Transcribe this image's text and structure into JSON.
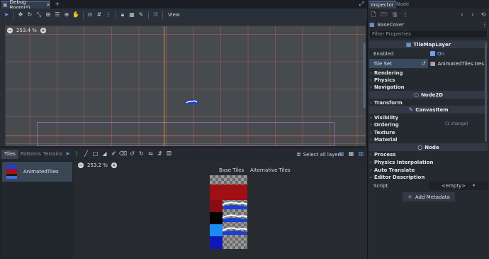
{
  "editor": {
    "scene_tab": "Debug Room(*)",
    "viewport_zoom": "253.4 %",
    "view_menu": "View"
  },
  "bottom_panel": {
    "tabs": [
      "Tiles",
      "Patterns",
      "Terrains"
    ],
    "select_all_layers": "Select all layers",
    "tileset_source": "AnimatedTiles",
    "atlas_zoom": "253.2 %",
    "base_tiles_label": "Base Tiles",
    "alternative_tiles_label": "Alternative Tiles"
  },
  "inspector": {
    "tabs": [
      "Inspector",
      "Node"
    ],
    "selected_node": "BaseCover",
    "filter_placeholder": "Filter Properties",
    "class_tilemaplayer": "TileMapLayer",
    "enabled_label": "Enabled",
    "enabled_value": "On",
    "tile_set_label": "Tile Set",
    "tile_set_value": "AnimatedTiles.tres",
    "tilemap_props": [
      "Rendering",
      "Physics",
      "Navigation"
    ],
    "class_node2d": "Node2D",
    "node2d_props": [
      "Transform"
    ],
    "class_canvasitem": "CanvasItem",
    "canvas_props": [
      "Visibility",
      "Ordering",
      "Texture",
      "Material"
    ],
    "ordering_change": "(1 change)",
    "class_node": "Node",
    "node_props": [
      "Process",
      "Physics Interpolation",
      "Auto Translate",
      "Editor Description"
    ],
    "script_label": "Script",
    "script_value": "<empty>",
    "add_metadata": "Add Metadata"
  },
  "colors": {
    "accent": "#6c9ef5",
    "panel": "#252a31",
    "viewport": "#474a4f",
    "grid": "#c86e50",
    "axis_y": "#d7a23a"
  }
}
